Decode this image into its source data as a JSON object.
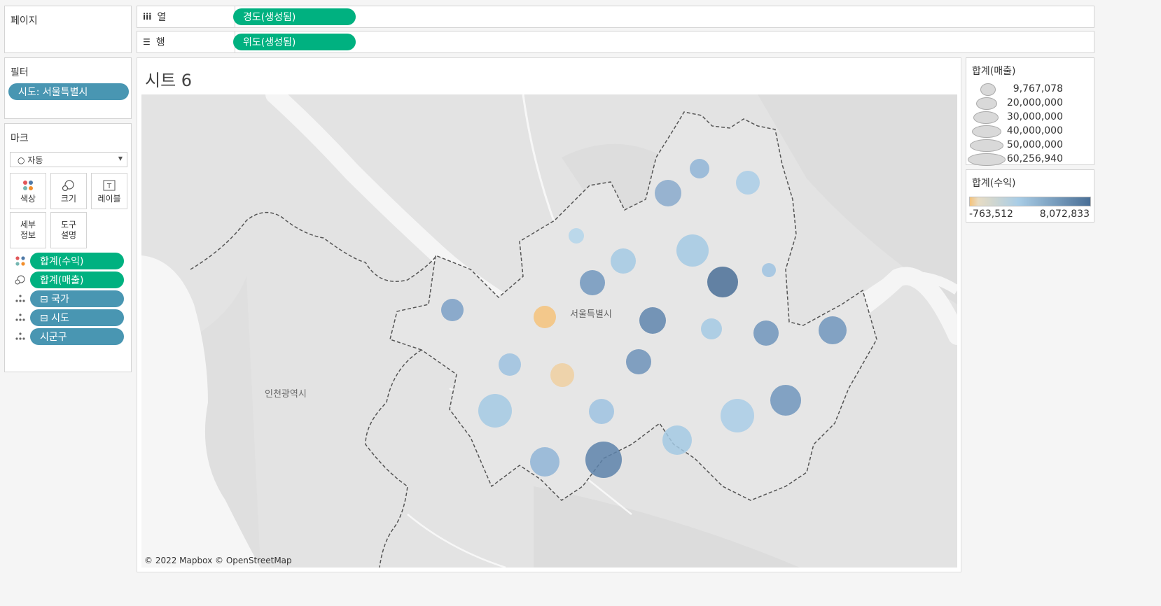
{
  "pages": {
    "title": "페이지"
  },
  "columns_shelf": {
    "icon": "iii",
    "label": "열",
    "pill": "경도(생성됨)"
  },
  "rows_shelf": {
    "icon": "☰",
    "label": "행",
    "pill": "위도(생성됨)"
  },
  "filters": {
    "title": "필터",
    "items": [
      "시도: 서울특별시"
    ]
  },
  "marks": {
    "title": "마크",
    "type_dropdown": "○ 자동",
    "buttons": {
      "color": "색상",
      "size": "크기",
      "label": "레이블",
      "detail": "세부\n정보",
      "tooltip": "도구\n설명"
    },
    "detail_line1": "세부",
    "detail_line2": "정보",
    "tooltip_line1": "도구",
    "tooltip_line2": "설명",
    "fields": [
      {
        "icon": "color-icon",
        "label": "합계(수익)",
        "color": "green"
      },
      {
        "icon": "size-icon",
        "label": "합계(매출)",
        "color": "green"
      },
      {
        "icon": "detail-icon",
        "label": "⊟ 국가",
        "color": "blue"
      },
      {
        "icon": "detail-icon",
        "label": "⊟ 시도",
        "color": "blue"
      },
      {
        "icon": "detail-icon",
        "label": "시군구",
        "color": "blue"
      }
    ]
  },
  "sheet": {
    "title": "시트 6"
  },
  "map": {
    "labels": {
      "seoul": "서울특별시",
      "incheon": "인천광역시"
    },
    "attribution": "© 2022 Mapbox © OpenStreetMap"
  },
  "size_legend": {
    "title": "합계(매출)",
    "values": [
      "9,767,078",
      "20,000,000",
      "30,000,000",
      "40,000,000",
      "50,000,000",
      "60,256,940"
    ]
  },
  "color_legend": {
    "title": "합계(수익)",
    "min": "-763,512",
    "max": "8,072,833",
    "colors": {
      "neg": "#f5c27a",
      "mid": "#a9cde6",
      "pos": "#4a6f96"
    }
  }
}
